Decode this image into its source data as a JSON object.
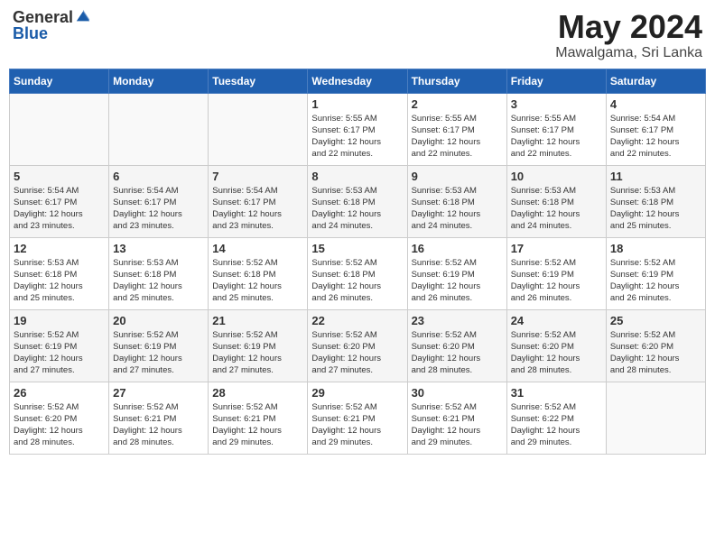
{
  "header": {
    "logo_general": "General",
    "logo_blue": "Blue",
    "month_title": "May 2024",
    "location": "Mawalgama, Sri Lanka"
  },
  "weekdays": [
    "Sunday",
    "Monday",
    "Tuesday",
    "Wednesday",
    "Thursday",
    "Friday",
    "Saturday"
  ],
  "weeks": [
    [
      {
        "day": "",
        "info": ""
      },
      {
        "day": "",
        "info": ""
      },
      {
        "day": "",
        "info": ""
      },
      {
        "day": "1",
        "info": "Sunrise: 5:55 AM\nSunset: 6:17 PM\nDaylight: 12 hours\nand 22 minutes."
      },
      {
        "day": "2",
        "info": "Sunrise: 5:55 AM\nSunset: 6:17 PM\nDaylight: 12 hours\nand 22 minutes."
      },
      {
        "day": "3",
        "info": "Sunrise: 5:55 AM\nSunset: 6:17 PM\nDaylight: 12 hours\nand 22 minutes."
      },
      {
        "day": "4",
        "info": "Sunrise: 5:54 AM\nSunset: 6:17 PM\nDaylight: 12 hours\nand 22 minutes."
      }
    ],
    [
      {
        "day": "5",
        "info": "Sunrise: 5:54 AM\nSunset: 6:17 PM\nDaylight: 12 hours\nand 23 minutes."
      },
      {
        "day": "6",
        "info": "Sunrise: 5:54 AM\nSunset: 6:17 PM\nDaylight: 12 hours\nand 23 minutes."
      },
      {
        "day": "7",
        "info": "Sunrise: 5:54 AM\nSunset: 6:17 PM\nDaylight: 12 hours\nand 23 minutes."
      },
      {
        "day": "8",
        "info": "Sunrise: 5:53 AM\nSunset: 6:18 PM\nDaylight: 12 hours\nand 24 minutes."
      },
      {
        "day": "9",
        "info": "Sunrise: 5:53 AM\nSunset: 6:18 PM\nDaylight: 12 hours\nand 24 minutes."
      },
      {
        "day": "10",
        "info": "Sunrise: 5:53 AM\nSunset: 6:18 PM\nDaylight: 12 hours\nand 24 minutes."
      },
      {
        "day": "11",
        "info": "Sunrise: 5:53 AM\nSunset: 6:18 PM\nDaylight: 12 hours\nand 25 minutes."
      }
    ],
    [
      {
        "day": "12",
        "info": "Sunrise: 5:53 AM\nSunset: 6:18 PM\nDaylight: 12 hours\nand 25 minutes."
      },
      {
        "day": "13",
        "info": "Sunrise: 5:53 AM\nSunset: 6:18 PM\nDaylight: 12 hours\nand 25 minutes."
      },
      {
        "day": "14",
        "info": "Sunrise: 5:52 AM\nSunset: 6:18 PM\nDaylight: 12 hours\nand 25 minutes."
      },
      {
        "day": "15",
        "info": "Sunrise: 5:52 AM\nSunset: 6:18 PM\nDaylight: 12 hours\nand 26 minutes."
      },
      {
        "day": "16",
        "info": "Sunrise: 5:52 AM\nSunset: 6:19 PM\nDaylight: 12 hours\nand 26 minutes."
      },
      {
        "day": "17",
        "info": "Sunrise: 5:52 AM\nSunset: 6:19 PM\nDaylight: 12 hours\nand 26 minutes."
      },
      {
        "day": "18",
        "info": "Sunrise: 5:52 AM\nSunset: 6:19 PM\nDaylight: 12 hours\nand 26 minutes."
      }
    ],
    [
      {
        "day": "19",
        "info": "Sunrise: 5:52 AM\nSunset: 6:19 PM\nDaylight: 12 hours\nand 27 minutes."
      },
      {
        "day": "20",
        "info": "Sunrise: 5:52 AM\nSunset: 6:19 PM\nDaylight: 12 hours\nand 27 minutes."
      },
      {
        "day": "21",
        "info": "Sunrise: 5:52 AM\nSunset: 6:19 PM\nDaylight: 12 hours\nand 27 minutes."
      },
      {
        "day": "22",
        "info": "Sunrise: 5:52 AM\nSunset: 6:20 PM\nDaylight: 12 hours\nand 27 minutes."
      },
      {
        "day": "23",
        "info": "Sunrise: 5:52 AM\nSunset: 6:20 PM\nDaylight: 12 hours\nand 28 minutes."
      },
      {
        "day": "24",
        "info": "Sunrise: 5:52 AM\nSunset: 6:20 PM\nDaylight: 12 hours\nand 28 minutes."
      },
      {
        "day": "25",
        "info": "Sunrise: 5:52 AM\nSunset: 6:20 PM\nDaylight: 12 hours\nand 28 minutes."
      }
    ],
    [
      {
        "day": "26",
        "info": "Sunrise: 5:52 AM\nSunset: 6:20 PM\nDaylight: 12 hours\nand 28 minutes."
      },
      {
        "day": "27",
        "info": "Sunrise: 5:52 AM\nSunset: 6:21 PM\nDaylight: 12 hours\nand 28 minutes."
      },
      {
        "day": "28",
        "info": "Sunrise: 5:52 AM\nSunset: 6:21 PM\nDaylight: 12 hours\nand 29 minutes."
      },
      {
        "day": "29",
        "info": "Sunrise: 5:52 AM\nSunset: 6:21 PM\nDaylight: 12 hours\nand 29 minutes."
      },
      {
        "day": "30",
        "info": "Sunrise: 5:52 AM\nSunset: 6:21 PM\nDaylight: 12 hours\nand 29 minutes."
      },
      {
        "day": "31",
        "info": "Sunrise: 5:52 AM\nSunset: 6:22 PM\nDaylight: 12 hours\nand 29 minutes."
      },
      {
        "day": "",
        "info": ""
      }
    ]
  ]
}
